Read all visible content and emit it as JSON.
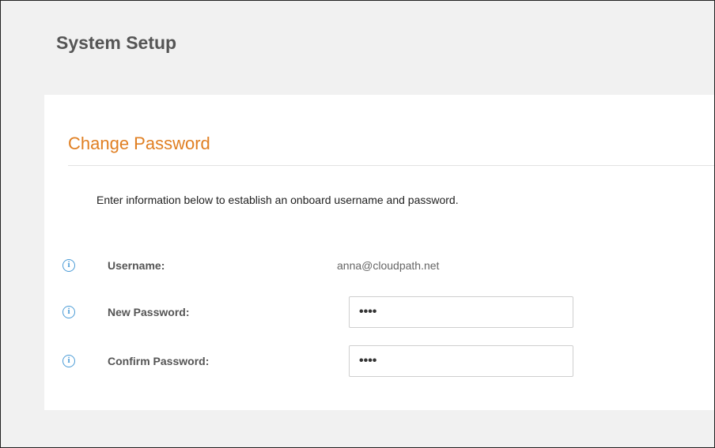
{
  "header": {
    "title": "System Setup"
  },
  "form": {
    "section_title": "Change Password",
    "instructions": "Enter information below to establish an onboard username and password.",
    "fields": [
      {
        "label": "Username:",
        "value": "anna@cloudpath.net",
        "icon": "info-icon"
      },
      {
        "label": "New Password:",
        "masked_value": "••••",
        "icon": "info-icon"
      },
      {
        "label": "Confirm Password:",
        "masked_value": "••••",
        "icon": "info-icon"
      }
    ]
  },
  "colors": {
    "accent": "#e07f22",
    "info_icon": "#4a9bd6",
    "page_background": "#f1f1f1",
    "panel_background": "#ffffff"
  }
}
